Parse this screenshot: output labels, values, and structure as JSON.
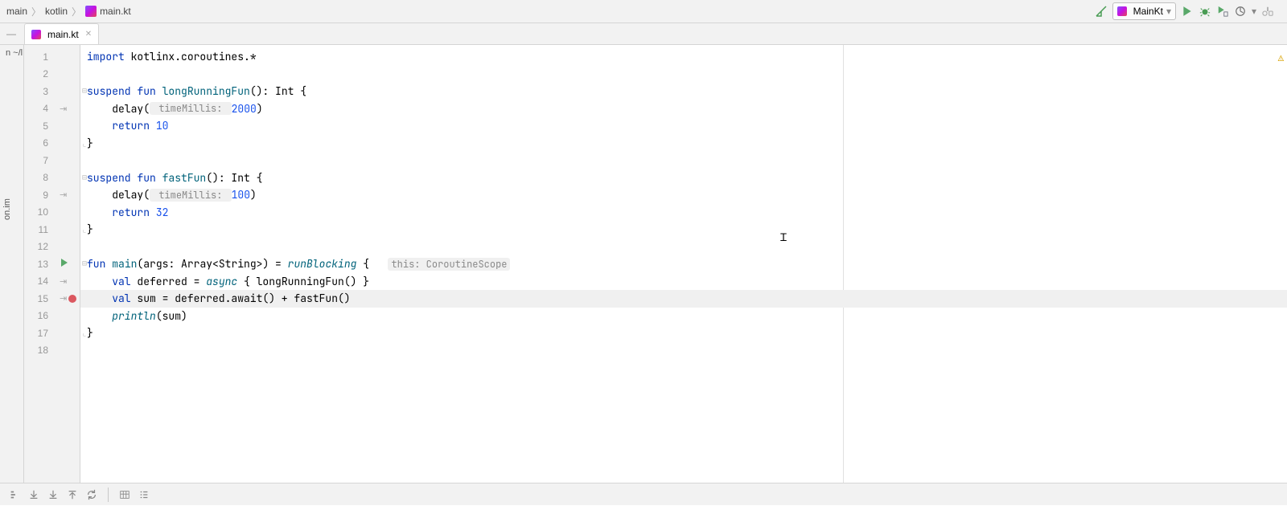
{
  "breadcrumb": {
    "items": [
      "main",
      "kotlin",
      "main.kt"
    ]
  },
  "toolbar": {
    "run_config": "MainKt"
  },
  "sidebar_left": {
    "label_top": "n ~/l",
    "label_side": "on.im"
  },
  "filetab": {
    "name": "main.kt"
  },
  "editor": {
    "highlighted_line": 15,
    "lines": [
      {
        "n": 1,
        "indent": 0,
        "segments": [
          {
            "cls": "kw",
            "t": "import"
          },
          {
            "t": " kotlinx.coroutines.*"
          }
        ],
        "gutter": []
      },
      {
        "n": 2,
        "indent": 0,
        "segments": [],
        "gutter": []
      },
      {
        "n": 3,
        "indent": 0,
        "segments": [
          {
            "cls": "kw",
            "t": "suspend fun"
          },
          {
            "t": " "
          },
          {
            "cls": "fnd",
            "t": "longRunningFun"
          },
          {
            "t": "(): Int {"
          }
        ],
        "fold": true,
        "gutter": []
      },
      {
        "n": 4,
        "indent": 1,
        "segments": [
          {
            "t": "delay("
          },
          {
            "cls": "hint",
            "t": " timeMillis: "
          },
          {
            "cls": "num",
            "t": "2000"
          },
          {
            "t": ")"
          }
        ],
        "gutter": [
          "suspend"
        ]
      },
      {
        "n": 5,
        "indent": 1,
        "segments": [
          {
            "cls": "kw",
            "t": "return"
          },
          {
            "t": " "
          },
          {
            "cls": "num",
            "t": "10"
          }
        ],
        "gutter": []
      },
      {
        "n": 6,
        "indent": 0,
        "segments": [
          {
            "t": "}"
          }
        ],
        "fold_end": true,
        "gutter": []
      },
      {
        "n": 7,
        "indent": 0,
        "segments": [],
        "gutter": []
      },
      {
        "n": 8,
        "indent": 0,
        "segments": [
          {
            "cls": "kw",
            "t": "suspend fun"
          },
          {
            "t": " "
          },
          {
            "cls": "fnd",
            "t": "fastFun"
          },
          {
            "t": "(): Int {"
          }
        ],
        "fold": true,
        "gutter": []
      },
      {
        "n": 9,
        "indent": 1,
        "segments": [
          {
            "t": "delay("
          },
          {
            "cls": "hint",
            "t": " timeMillis: "
          },
          {
            "cls": "num",
            "t": "100"
          },
          {
            "t": ")"
          }
        ],
        "gutter": [
          "suspend"
        ]
      },
      {
        "n": 10,
        "indent": 1,
        "segments": [
          {
            "cls": "kw",
            "t": "return"
          },
          {
            "t": " "
          },
          {
            "cls": "num",
            "t": "32"
          }
        ],
        "gutter": []
      },
      {
        "n": 11,
        "indent": 0,
        "segments": [
          {
            "t": "}"
          }
        ],
        "fold_end": true,
        "gutter": []
      },
      {
        "n": 12,
        "indent": 0,
        "segments": [],
        "gutter": []
      },
      {
        "n": 13,
        "indent": 0,
        "segments": [
          {
            "cls": "kw",
            "t": "fun"
          },
          {
            "t": " "
          },
          {
            "cls": "fnd",
            "t": "main"
          },
          {
            "t": "("
          },
          {
            "cls": "",
            "t": "args"
          },
          {
            "t": ": Array<String>) = "
          },
          {
            "cls": "fn",
            "t": "runBlocking"
          },
          {
            "t": " {   "
          },
          {
            "cls": "hint",
            "t": "this: CoroutineScope"
          }
        ],
        "fold": true,
        "gutter": [
          "run"
        ]
      },
      {
        "n": 14,
        "indent": 1,
        "segments": [
          {
            "cls": "kw",
            "t": "val"
          },
          {
            "t": " deferred = "
          },
          {
            "cls": "fn",
            "t": "async"
          },
          {
            "t": " { longRunningFun() }"
          }
        ],
        "gutter": [
          "suspend"
        ]
      },
      {
        "n": 15,
        "indent": 1,
        "segments": [
          {
            "cls": "kw",
            "t": "val"
          },
          {
            "t": " sum = deferred.await() + fastFun()"
          }
        ],
        "gutter": [
          "suspend",
          "breakpoint"
        ]
      },
      {
        "n": 16,
        "indent": 1,
        "segments": [
          {
            "cls": "fn",
            "t": "println"
          },
          {
            "t": "(sum)"
          }
        ],
        "gutter": []
      },
      {
        "n": 17,
        "indent": 0,
        "segments": [
          {
            "t": "}"
          }
        ],
        "fold_end": true,
        "gutter": []
      },
      {
        "n": 18,
        "indent": 0,
        "segments": [],
        "gutter": []
      }
    ]
  }
}
